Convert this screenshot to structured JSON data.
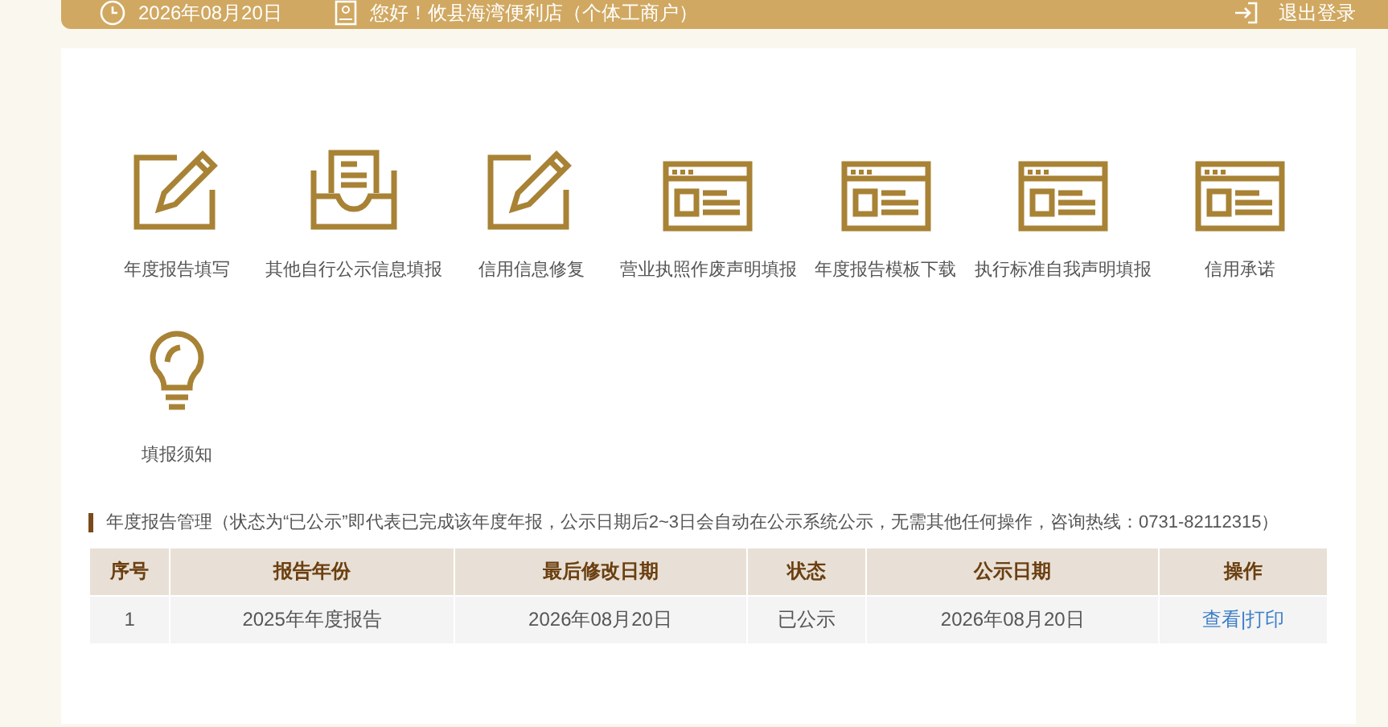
{
  "header": {
    "date": "2026年08月20日",
    "greeting": "您好！攸县海湾便利店（个体工商户）",
    "logout": "退出登录"
  },
  "services": [
    {
      "kind": "edit",
      "label": "年度报告填写"
    },
    {
      "kind": "inbox",
      "label": "其他自行公示信息填报"
    },
    {
      "kind": "edit",
      "label": "信用信息修复"
    },
    {
      "kind": "form",
      "label": "营业执照作废声明填报"
    },
    {
      "kind": "form",
      "label": "年度报告模板下载"
    },
    {
      "kind": "form",
      "label": "执行标准自我声明填报"
    },
    {
      "kind": "form",
      "label": "信用承诺"
    },
    {
      "kind": "bulb",
      "label": "填报须知"
    }
  ],
  "section_title": "年度报告管理（状态为“已公示”即代表已完成该年度年报，公示日期后2~3日会自动在公示系统公示，无需其他任何操作，咨询热线：0731-82112315）",
  "table": {
    "columns": [
      "序号",
      "报告年份",
      "最后修改日期",
      "状态",
      "公示日期",
      "操作"
    ],
    "rows": [
      {
        "cells": [
          "1",
          "2025年年度报告",
          "2026年08月20日",
          "已公示",
          "2026年08月20日"
        ],
        "action": "查看|打印"
      }
    ]
  }
}
